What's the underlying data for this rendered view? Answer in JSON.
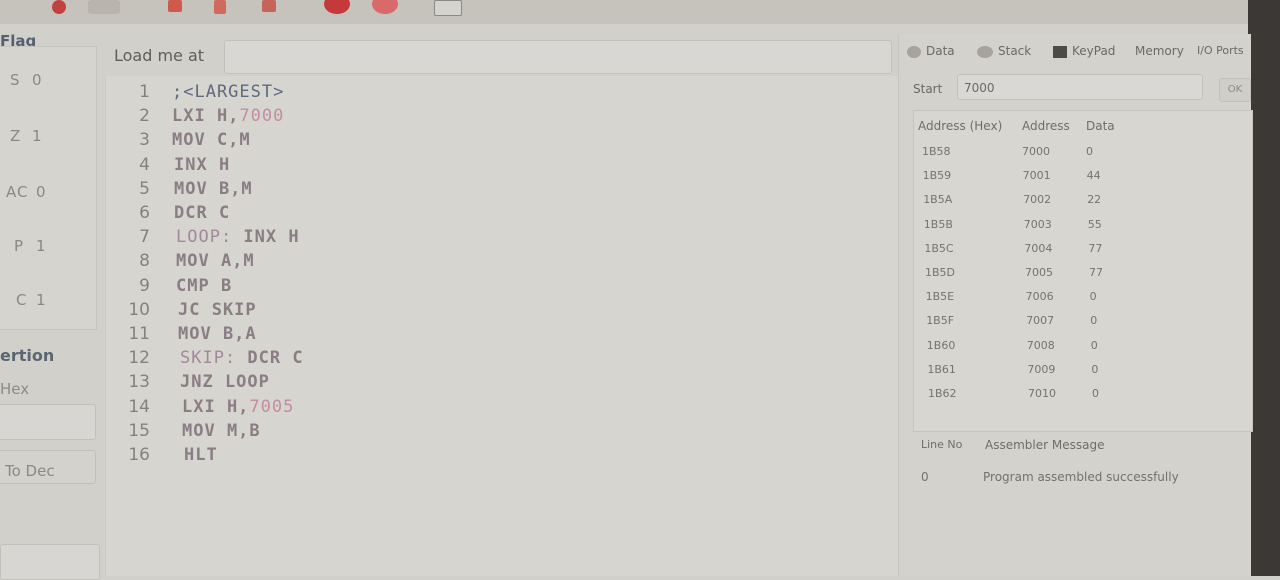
{
  "flags": {
    "title": "Flag",
    "items": [
      {
        "name": "S",
        "value": "0"
      },
      {
        "name": "Z",
        "value": "1"
      },
      {
        "name": "AC",
        "value": "0"
      },
      {
        "name": "P",
        "value": "1"
      },
      {
        "name": "C",
        "value": "1"
      }
    ]
  },
  "conversion": {
    "title": "ertion",
    "hex_label": "Hex",
    "to_dec_label": "To Dec"
  },
  "load": {
    "label": "Load me at",
    "value": ""
  },
  "editor": {
    "lines": [
      {
        "n": "1",
        "parts": [
          {
            "t": ";<LARGEST>",
            "c": "comment"
          }
        ]
      },
      {
        "n": "2",
        "parts": [
          {
            "t": "LXI H,",
            "c": "kw"
          },
          {
            "t": "7000",
            "c": "num"
          }
        ]
      },
      {
        "n": "3",
        "parts": [
          {
            "t": "MOV C,M",
            "c": "kw"
          }
        ]
      },
      {
        "n": "4",
        "parts": [
          {
            "t": "INX H",
            "c": "kw"
          }
        ]
      },
      {
        "n": "5",
        "parts": [
          {
            "t": "MOV B,M",
            "c": "kw"
          }
        ]
      },
      {
        "n": "6",
        "parts": [
          {
            "t": "DCR C",
            "c": "kw"
          }
        ]
      },
      {
        "n": "7",
        "parts": [
          {
            "t": "LOOP:",
            "c": "lbl"
          },
          {
            "t": " INX H",
            "c": "kw"
          }
        ]
      },
      {
        "n": "8",
        "parts": [
          {
            "t": "MOV A,M",
            "c": "kw"
          }
        ]
      },
      {
        "n": "9",
        "parts": [
          {
            "t": "CMP B",
            "c": "kw"
          }
        ]
      },
      {
        "n": "10",
        "parts": [
          {
            "t": "JC SKIP",
            "c": "kw"
          }
        ]
      },
      {
        "n": "11",
        "parts": [
          {
            "t": "MOV B,A",
            "c": "kw"
          }
        ]
      },
      {
        "n": "12",
        "parts": [
          {
            "t": "SKIP:",
            "c": "lbl"
          },
          {
            "t": " DCR C",
            "c": "kw"
          }
        ]
      },
      {
        "n": "13",
        "parts": [
          {
            "t": "JNZ LOOP",
            "c": "kw"
          }
        ]
      },
      {
        "n": "14",
        "parts": [
          {
            "t": "LXI H,",
            "c": "kw"
          },
          {
            "t": "7005",
            "c": "num"
          }
        ]
      },
      {
        "n": "15",
        "parts": [
          {
            "t": "MOV M,B",
            "c": "kw"
          }
        ]
      },
      {
        "n": "16",
        "parts": [
          {
            "t": "HLT",
            "c": "kw"
          }
        ]
      }
    ]
  },
  "tabs": {
    "data": "Data",
    "stack": "Stack",
    "keypad": "KeyPad",
    "memory": "Memory",
    "io_ports": "I/O Ports"
  },
  "memory": {
    "start_label": "Start",
    "start_value": "7000",
    "ok_label": "OK",
    "headers": [
      "Address (Hex)",
      "Address",
      "Data"
    ],
    "rows": [
      [
        "1B58",
        "7000",
        "0"
      ],
      [
        "1B59",
        "7001",
        "44"
      ],
      [
        "1B5A",
        "7002",
        "22"
      ],
      [
        "1B5B",
        "7003",
        "55"
      ],
      [
        "1B5C",
        "7004",
        "77"
      ],
      [
        "1B5D",
        "7005",
        "77"
      ],
      [
        "1B5E",
        "7006",
        "0"
      ],
      [
        "1B5F",
        "7007",
        "0"
      ],
      [
        "1B60",
        "7008",
        "0"
      ],
      [
        "1B61",
        "7009",
        "0"
      ],
      [
        "1B62",
        "7010",
        "0"
      ]
    ]
  },
  "messages": {
    "headers": [
      "Line No",
      "Assembler Message"
    ],
    "rows": [
      [
        "0",
        "Program assembled successfully"
      ]
    ]
  }
}
